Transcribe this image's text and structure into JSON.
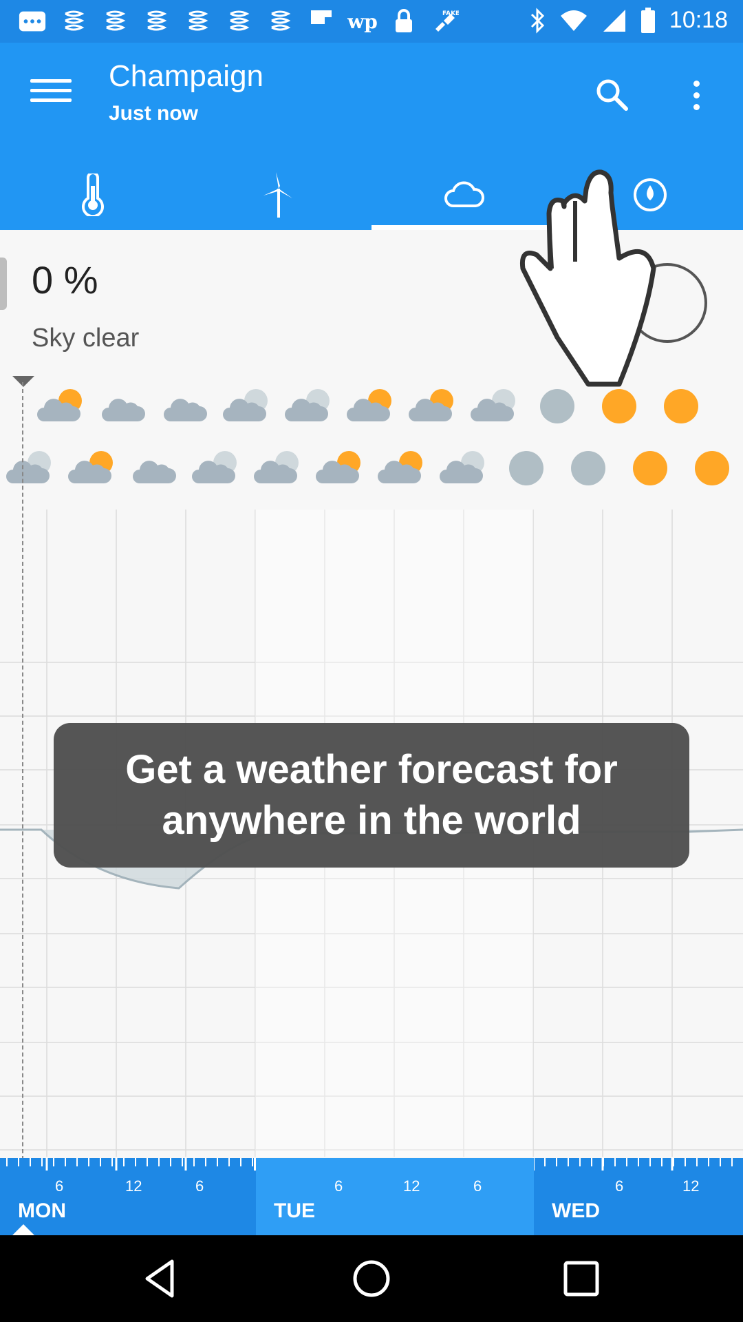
{
  "status": {
    "time": "10:18",
    "left_icons": [
      "message-icon",
      "weather-alert-icon",
      "weather-alert-icon",
      "weather-alert-icon",
      "weather-alert-icon",
      "weather-alert-icon",
      "weather-alert-icon",
      "flipboard-icon",
      "washington-post-icon",
      "lock-icon",
      "fake-gps-icon"
    ],
    "right_icons": [
      "bluetooth-icon",
      "wifi-icon",
      "signal-icon",
      "battery-icon"
    ]
  },
  "appbar": {
    "title": "Champaign",
    "subtitle": "Just now",
    "background": "#2196f3"
  },
  "tabs": [
    {
      "name": "temperature",
      "icon": "thermometer-icon"
    },
    {
      "name": "wind",
      "icon": "wind-turbine-icon"
    },
    {
      "name": "cloud",
      "icon": "cloud-icon",
      "selected": true
    },
    {
      "name": "precipitation",
      "icon": "drop-icon"
    }
  ],
  "current": {
    "value": "0 %",
    "description": "Sky clear"
  },
  "tooltip": {
    "text": "Get a weather forecast for anywhere in the world"
  },
  "forecast_rows": [
    [
      "partly-sunny",
      "cloudy",
      "cloudy",
      "partly-cloudy",
      "partly-cloudy",
      "partly-sunny",
      "partly-sunny",
      "partly-cloudy",
      "clear-night",
      "sunny",
      "sunny"
    ],
    [
      "partly-cloudy",
      "partly-sunny",
      "cloudy",
      "partly-cloudy",
      "partly-cloudy",
      "partly-sunny",
      "partly-sunny",
      "partly-cloudy",
      "clear-night",
      "clear-night",
      "sunny",
      "sunny"
    ]
  ],
  "timeline": {
    "days": [
      {
        "label": "MON",
        "hours": [
          "6",
          "12",
          "6"
        ]
      },
      {
        "label": "TUE",
        "hours": [
          "6",
          "12",
          "6"
        ]
      },
      {
        "label": "WED",
        "hours": [
          "6",
          "12"
        ]
      }
    ]
  },
  "colors": {
    "cloud": "#a6b4bf",
    "sun": "#ffa726",
    "moon": "#b0bec5"
  }
}
